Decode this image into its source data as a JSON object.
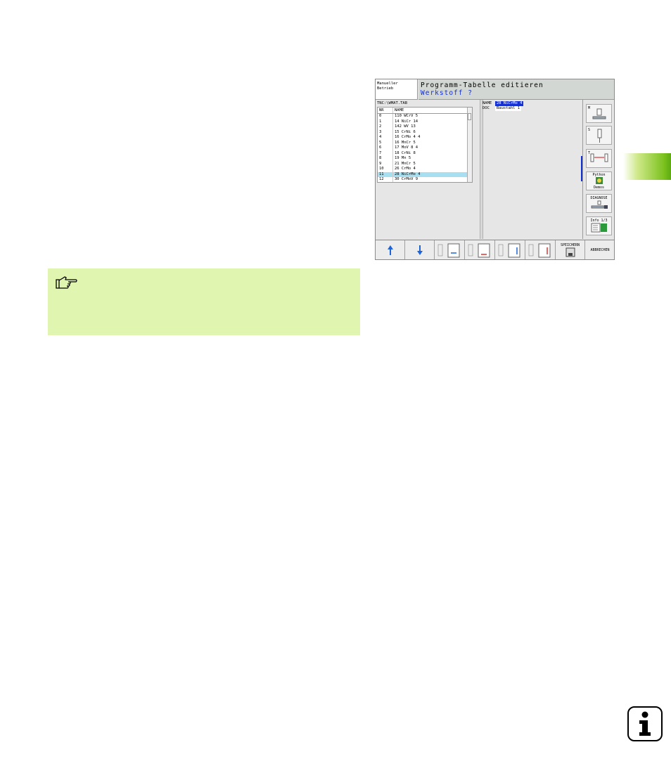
{
  "screenshot": {
    "mode_lines": [
      "Manueller",
      "Betrieb"
    ],
    "title": "Programm-Tabelle editieren",
    "prompt": "Werkstoff ?",
    "path": "TNC:\\WMAT.TAB",
    "table": {
      "columns": [
        "NR",
        "NAME"
      ],
      "rows": [
        [
          "0",
          "110 WCrV 5"
        ],
        [
          "1",
          "14 NiCr 14"
        ],
        [
          "2",
          "142 WV 13"
        ],
        [
          "3",
          "15 CrNi 6"
        ],
        [
          "4",
          "16 CrMo 4 4"
        ],
        [
          "5",
          "16 MnCr 5"
        ],
        [
          "6",
          "17 MoV 8 4"
        ],
        [
          "7",
          "18 CrNi 8"
        ],
        [
          "8",
          "19 Mn 5"
        ],
        [
          "9",
          "21 MnCr 5"
        ],
        [
          "10",
          "26 CrMo 4"
        ],
        [
          "11",
          "28 NiCrMo 4"
        ],
        [
          "12",
          "30 CrMoV 9"
        ]
      ],
      "selected_index": 11
    },
    "form": {
      "name_label": "NAME",
      "name_value": "28 NiCrMo 4",
      "doc_label": "DOC",
      "doc_value": "Baustahl 1"
    },
    "sidebar": {
      "m_label": "M",
      "s_label": "S",
      "t_label": "T",
      "python_label": "Python",
      "demos_label": "Demos",
      "diagnose_label": "DIAGNOSE",
      "info_label": "Info 1/3"
    },
    "softkeys": {
      "speichern": "SPEICHERN",
      "abbrechen": "ABBRECHEN"
    }
  },
  "colors": {
    "note_bg": "#e0f5b0",
    "accent_blue": "#1530d0",
    "chapter_green": "#7cc21e",
    "selected_row": "#a8dff0"
  }
}
